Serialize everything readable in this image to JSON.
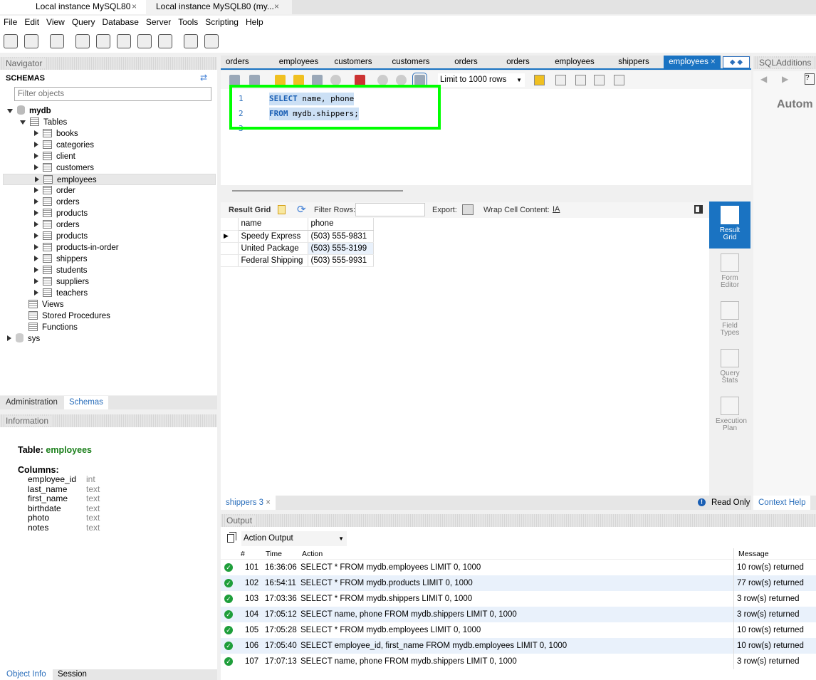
{
  "window_tabs": [
    {
      "label": "Local instance MySQL80",
      "active": true
    },
    {
      "label": "Local instance MySQL80 (my...",
      "active": false
    }
  ],
  "menu": [
    "File",
    "Edit",
    "View",
    "Query",
    "Database",
    "Server",
    "Tools",
    "Scripting",
    "Help"
  ],
  "toolbar_icons": [
    "new-sql-tab-icon",
    "open-sql-file-icon",
    "schema-inspector-icon",
    "create-schema-icon",
    "create-table-icon",
    "create-view-icon",
    "create-procedure-icon",
    "create-function-icon",
    "search-table-data-icon",
    "reconnect-icon"
  ],
  "navigator": {
    "title": "Navigator",
    "schemas_label": "SCHEMAS",
    "filter_placeholder": "Filter objects",
    "schemas": [
      {
        "name": "mydb",
        "tables_label": "Tables",
        "tables": [
          "books",
          "categories",
          "client",
          "customers",
          "employees",
          "order",
          "orders",
          "products",
          "orders",
          "products",
          "products-in-order",
          "shippers",
          "students",
          "suppliers",
          "teachers"
        ],
        "selected_table": "employees",
        "others": [
          "Views",
          "Stored Procedures",
          "Functions"
        ]
      },
      {
        "name": "sys"
      }
    ],
    "bottom_tabs": [
      "Administration",
      "Schemas"
    ],
    "active_tab": "Schemas"
  },
  "information": {
    "title": "Information",
    "table_label": "Table:",
    "table_name": "employees",
    "columns_label": "Columns:",
    "columns": [
      {
        "name": "employee_id",
        "type": "int"
      },
      {
        "name": "last_name",
        "type": "text"
      },
      {
        "name": "first_name",
        "type": "text"
      },
      {
        "name": "birthdate",
        "type": "text"
      },
      {
        "name": "photo",
        "type": "text"
      },
      {
        "name": "notes",
        "type": "text"
      }
    ],
    "bottom_tabs": [
      "Object Info",
      "Session"
    ]
  },
  "editor_tabs": [
    "orders",
    "employees",
    "customers",
    "customers",
    "orders",
    "orders",
    "employees",
    "shippers",
    "employees"
  ],
  "active_editor_tab": "employees",
  "editor_toolbar": {
    "limit": "Limit to 1000 rows"
  },
  "editor": {
    "lines": [
      {
        "n": "1",
        "kw": "SELECT",
        "rest": " name, phone"
      },
      {
        "n": "2",
        "kw": "FROM",
        "rest": " mydb.shippers;"
      },
      {
        "n": "3",
        "kw": "",
        "rest": ""
      }
    ]
  },
  "highlight_color": "#00ff00",
  "result_toolbar": {
    "result_grid": "Result Grid",
    "filter": "Filter Rows:",
    "export": "Export:",
    "wrap": "Wrap Cell Content:"
  },
  "result": {
    "columns": [
      "name",
      "phone"
    ],
    "rows": [
      [
        "Speedy Express",
        "(503) 555-9831"
      ],
      [
        "United Package",
        "(503) 555-3199"
      ],
      [
        "Federal Shipping",
        "(503) 555-9931"
      ]
    ]
  },
  "side_buttons": [
    "Result Grid",
    "Form Editor",
    "Field Types",
    "Query Stats",
    "Execution Plan"
  ],
  "result_tab": "shippers 3",
  "read_only": "Read Only",
  "sql_additions": {
    "title": "SQLAdditions",
    "text": "Autom",
    "context_help": "Context Help"
  },
  "output": {
    "title": "Output",
    "selector": "Action Output",
    "columns": [
      "#",
      "Time",
      "Action",
      "Message"
    ],
    "rows": [
      [
        "101",
        "16:36:06",
        "SELECT * FROM mydb.employees LIMIT 0, 1000",
        "10 row(s) returned"
      ],
      [
        "102",
        "16:54:11",
        "SELECT * FROM mydb.products LIMIT 0, 1000",
        "77 row(s) returned"
      ],
      [
        "103",
        "17:03:36",
        "SELECT * FROM mydb.shippers LIMIT 0, 1000",
        "3 row(s) returned"
      ],
      [
        "104",
        "17:05:12",
        "SELECT name, phone  FROM mydb.shippers LIMIT 0, 1000",
        "3 row(s) returned"
      ],
      [
        "105",
        "17:05:28",
        "SELECT * FROM mydb.employees LIMIT 0, 1000",
        "10 row(s) returned"
      ],
      [
        "106",
        "17:05:40",
        "SELECT employee_id, first_name FROM mydb.employees LIMIT 0, 1000",
        "10 row(s) returned"
      ],
      [
        "107",
        "17:07:13",
        "SELECT name, phone FROM mydb.shippers LIMIT 0, 1000",
        "3 row(s) returned"
      ]
    ]
  }
}
